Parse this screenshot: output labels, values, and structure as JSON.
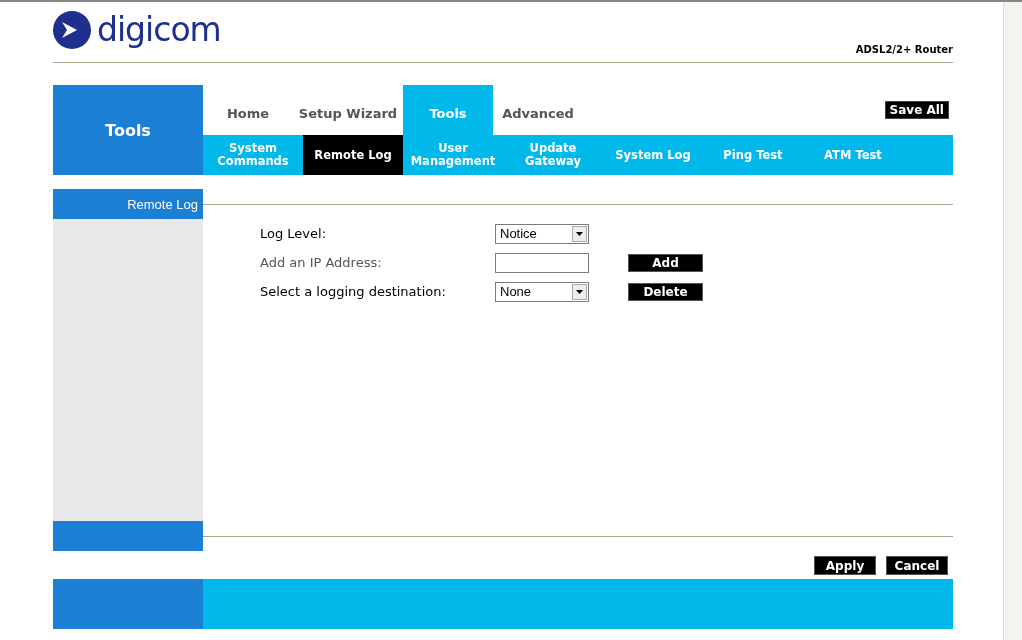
{
  "logo": {
    "text": "digicom"
  },
  "product": "ADSL2/2+ Router",
  "section_title": "Tools",
  "tabs": [
    {
      "label": "Home",
      "selected": false
    },
    {
      "label": "Setup Wizard",
      "selected": false
    },
    {
      "label": "Tools",
      "selected": true
    },
    {
      "label": "Advanced",
      "selected": false
    }
  ],
  "save_all": "Save All",
  "subtabs": [
    {
      "label": "System\nCommands",
      "selected": false
    },
    {
      "label": "Remote Log",
      "selected": true
    },
    {
      "label": "User\nManagement",
      "selected": false
    },
    {
      "label": "Update\nGateway",
      "selected": false
    },
    {
      "label": "System Log",
      "selected": false
    },
    {
      "label": "Ping Test",
      "selected": false
    },
    {
      "label": "ATM Test",
      "selected": false
    }
  ],
  "sidebar": {
    "title": "Remote Log"
  },
  "form": [
    {
      "kind": "select",
      "label": "Log Level:",
      "value": "Notice",
      "disabled": false
    },
    {
      "kind": "input",
      "label": "Add an IP Address:",
      "disabled": true,
      "button": "Add"
    },
    {
      "kind": "select",
      "label": "Select a logging destination:",
      "value": "None",
      "disabled": false,
      "button": "Delete"
    }
  ],
  "buttons": [
    "Apply",
    "Cancel"
  ]
}
